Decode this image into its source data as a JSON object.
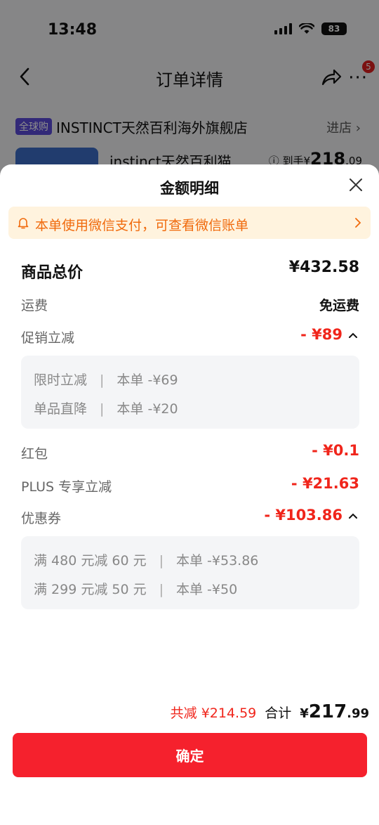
{
  "status": {
    "time": "13:48",
    "battery": "83"
  },
  "nav": {
    "title": "订单详情",
    "badge": "5"
  },
  "shop": {
    "tag": "全球购",
    "name": "INSTINCT天然百利海外旗舰店",
    "enter": "进店"
  },
  "product": {
    "name": "instinct天然百利猫...",
    "price_prefix": "到手¥",
    "price_int": "218",
    "price_dec": ".09"
  },
  "sheet": {
    "title": "金额明细",
    "notice": "本单使用微信支付，可查看微信账单",
    "total": {
      "label": "商品总价",
      "value": "¥432.58"
    },
    "shipping": {
      "label": "运费",
      "value": "免运费"
    },
    "promo": {
      "label": "促销立减",
      "value": "- ¥89",
      "items": [
        {
          "name": "限时立减",
          "sep": "|",
          "value": "本单 -¥69"
        },
        {
          "name": "单品直降",
          "sep": "|",
          "value": "本单 -¥20"
        }
      ]
    },
    "redpacket": {
      "label": "红包",
      "value": "- ¥0.1"
    },
    "plus": {
      "label": "PLUS 专享立减",
      "value": "- ¥21.63"
    },
    "coupon": {
      "label": "优惠券",
      "value": "- ¥103.86",
      "items": [
        {
          "name": "满 480 元减 60 元",
          "sep": "|",
          "value": "本单 -¥53.86"
        },
        {
          "name": "满 299 元减 50 元",
          "sep": "|",
          "value": "本单 -¥50"
        }
      ]
    },
    "summary": {
      "save": "共减 ¥214.59",
      "label": "合计",
      "currency": "¥",
      "int": "217",
      "dec": ".99"
    },
    "confirm": "确定"
  },
  "colors": {
    "accent": "#f5212d",
    "discount": "#f0251b",
    "notice_bg": "#fff3de",
    "notice_text": "#f06a0c"
  }
}
